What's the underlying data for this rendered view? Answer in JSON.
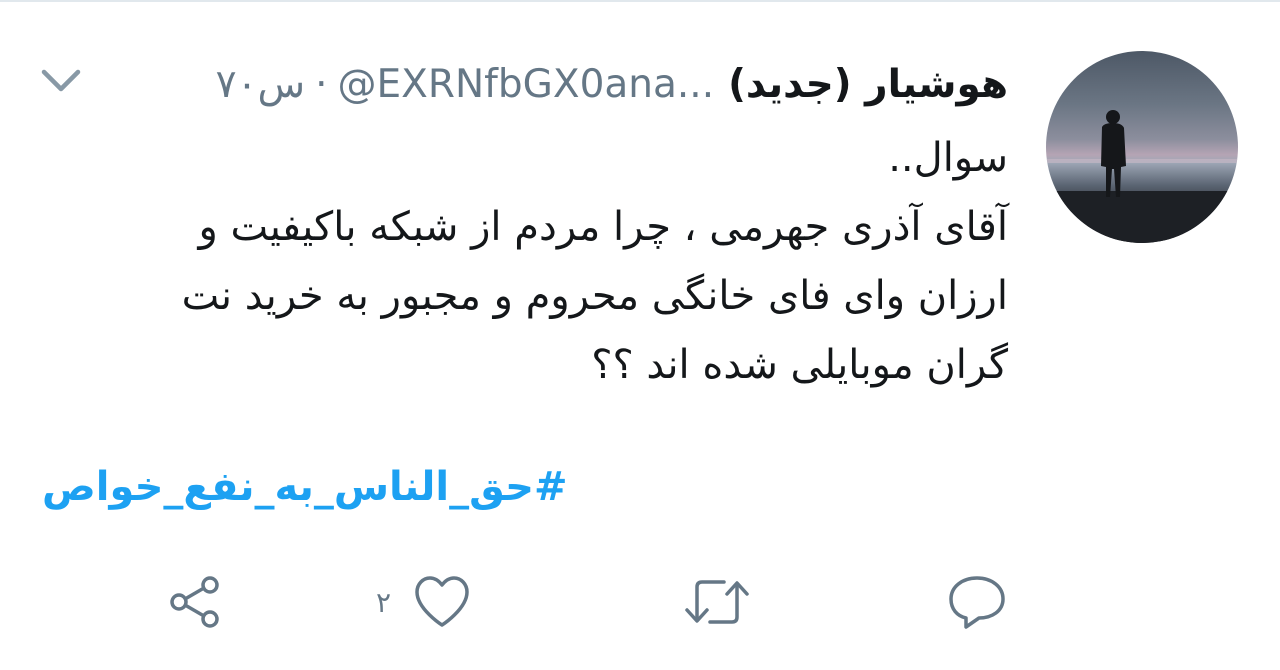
{
  "tweet": {
    "display_name": "هوشیار (جدید)",
    "handle": "@EXRNfbGX0ana...",
    "separator": "·",
    "time": "۷۰س",
    "text_lines": [
      "سوال..",
      "آقای آذری جهرمی ، چرا مردم از شبکه باکیفیت و",
      "ارزان وای فای خانگی محروم و مجبور به خرید نت",
      "گران موبایلی شده اند ؟؟"
    ],
    "hashtag": "#حق_الناس_به_نفع_خواص"
  },
  "actions": {
    "reply_icon": "reply-icon",
    "retweet_icon": "retweet-icon",
    "like_icon": "like-icon",
    "like_count": "۲",
    "share_icon": "share-icon"
  },
  "colors": {
    "text": "#14171a",
    "secondary": "#657786",
    "accent": "#1da1f2",
    "divider": "#e1e8ed"
  }
}
